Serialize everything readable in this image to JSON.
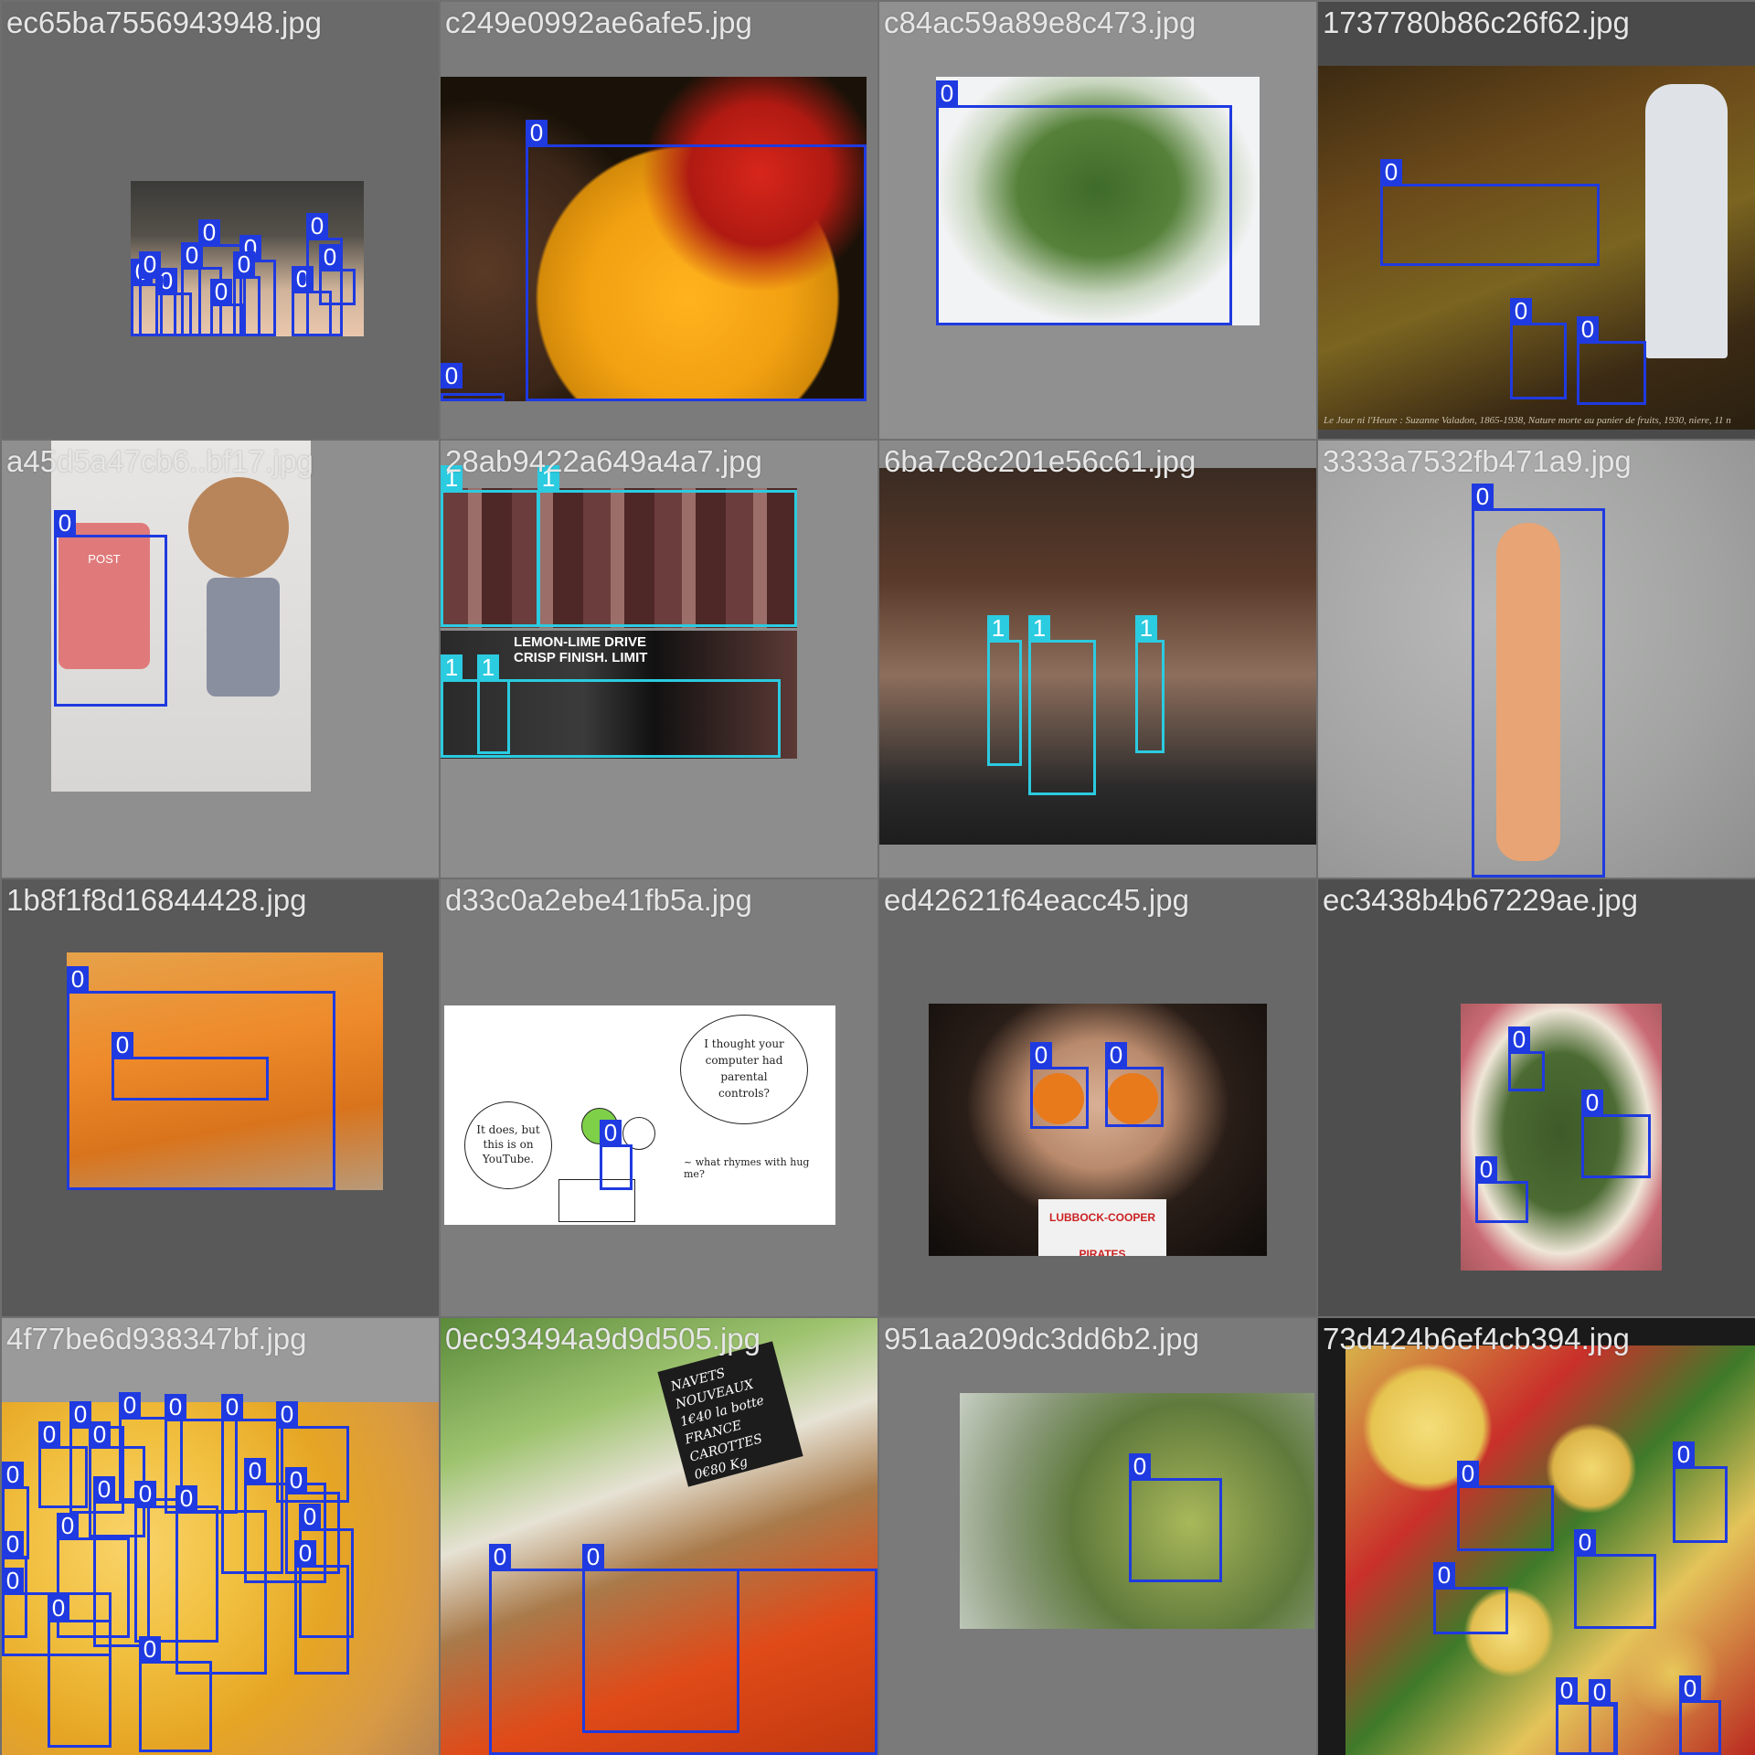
{
  "mosaic": {
    "box_color_class_0": "#1f3ae0",
    "box_color_class_1": "#2bcbe0",
    "tiles": [
      {
        "filename": "ec65ba7556943948.jpg",
        "class_labels": [
          "0",
          "0",
          "0",
          "0",
          "0",
          "0",
          "0",
          "0",
          "0",
          "0",
          "0"
        ]
      },
      {
        "filename": "c249e0992ae6afe5.jpg",
        "class_labels": [
          "0",
          "0"
        ]
      },
      {
        "filename": "c84ac59a89e8c473.jpg",
        "class_labels": [
          "0"
        ]
      },
      {
        "filename": "1737780b86c26f62.jpg",
        "class_labels": [
          "0",
          "0",
          "0"
        ],
        "caption": "Le Jour ni l'Heure : Suzanne Valadon, 1865-1938, Nature morte au panier de fruits, 1930, niere, 11 n"
      },
      {
        "filename": "a45d5a47cb6..bf17.jpg",
        "class_labels": [
          "0"
        ],
        "image_text": "POST"
      },
      {
        "filename": "28ab9422a649a4a7.jpg",
        "class_labels": [
          "1",
          "1",
          "1",
          "1"
        ],
        "image_text": "LEMON-LIME DRIVE CRISP FINISH. LIMIT"
      },
      {
        "filename": "6ba7c8c201e56c61.jpg",
        "class_labels": [
          "1",
          "1",
          "1"
        ]
      },
      {
        "filename": "3333a7532fb471a9.jpg",
        "class_labels": [
          "0"
        ]
      },
      {
        "filename": "1b8f1f8d16844428.jpg",
        "class_labels": [
          "0",
          "0"
        ]
      },
      {
        "filename": "d33c0a2ebe41fb5a.jpg",
        "class_labels": [
          "0"
        ],
        "comic": {
          "bubble_left": "It does, but this is on YouTube.",
          "bubble_right": "I thought your computer had parental controls?",
          "caption": "~ what rhymes with hug me?"
        }
      },
      {
        "filename": "ed42621f64eacc45.jpg",
        "class_labels": [
          "0",
          "0"
        ],
        "image_text": "LUBBOCK-COOPER PIRATES"
      },
      {
        "filename": "ec3438b4b67229ae.jpg",
        "class_labels": [
          "0",
          "0",
          "0"
        ]
      },
      {
        "filename": "4f77be6d938347bf.jpg",
        "class_labels": [
          "0",
          "0",
          "0",
          "0",
          "0",
          "0",
          "0",
          "0",
          "0",
          "0",
          "0",
          "0",
          "0",
          "0",
          "0",
          "0",
          "0",
          "0",
          "0",
          "0"
        ]
      },
      {
        "filename": "0ec93494a9d9d505.jpg",
        "class_labels": [
          "0",
          "0"
        ],
        "image_text": "NAVETS NOUVEAUX 1€40 la botte FRANCE CAROTTES 0€80 Kg"
      },
      {
        "filename": "951aa209dc3dd6b2.jpg",
        "class_labels": [
          "0"
        ]
      },
      {
        "filename": "73d424b6ef4cb394.jpg",
        "class_labels": [
          "0",
          "0",
          "0",
          "0",
          "0",
          "0",
          "0"
        ]
      }
    ]
  }
}
